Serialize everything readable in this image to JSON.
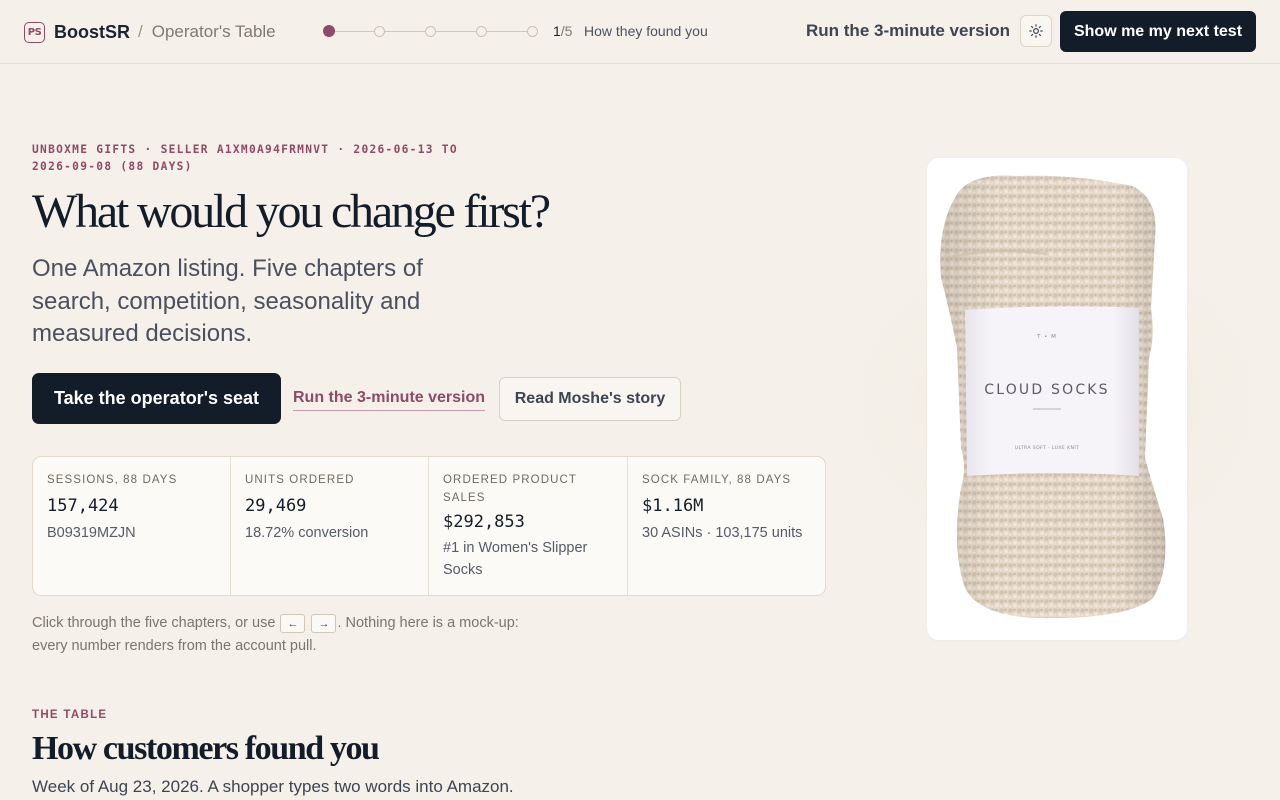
{
  "topbar": {
    "logo_text": "PS",
    "brand": "BoostSR",
    "separator": "/",
    "crumb": "Operator's Table",
    "progress": {
      "current": 1,
      "total": 5,
      "current_text": "1",
      "total_text": "/5"
    },
    "step_label": "How they found you",
    "quick_link": "Run the 3-minute version",
    "theme_icon": "sun-icon",
    "cta": "Show me my next test"
  },
  "hero": {
    "eyebrow": "UNBOXME GIFTS · SELLER A1XM0A94FRMNVT · 2026-06-13 TO 2026-09-08 (88 DAYS)",
    "title": "What would you change first?",
    "subtitle": "One Amazon listing. Five chapters of search, competition, seasonality and measured decisions.",
    "primary_button": "Take the operator's seat",
    "link_button": "Run the 3-minute version",
    "secondary_button": "Read Moshe's story"
  },
  "stats": [
    {
      "label": "SESSIONS, 88 DAYS",
      "value": "157,424",
      "sub": "B09319MZJN"
    },
    {
      "label": "UNITS ORDERED",
      "value": "29,469",
      "sub": "18.72% conversion"
    },
    {
      "label": "ORDERED PRODUCT SALES",
      "value": "$292,853",
      "sub": "#1 in Women's Slipper Socks"
    },
    {
      "label": "SOCK FAMILY, 88 DAYS",
      "value": "$1.16M",
      "sub": "30 ASINs · 103,175 units"
    }
  ],
  "hint": {
    "before": "Click through the five chapters, or use ",
    "key_prev": "←",
    "key_next": "→",
    "after": ". Nothing here is a mock-up: every number renders from the account pull."
  },
  "section": {
    "eyebrow": "THE TABLE",
    "title": "How customers found you",
    "subtitle": "Week of Aug 23, 2026. A shopper types two words into Amazon."
  },
  "product": {
    "band_mark": "T • M",
    "band_title": "CLOUD SOCKS",
    "band_tagline": "ULTRA SOFT · LUXE KNIT",
    "colors": {
      "sock": "#e3d6c7",
      "band": "#f4f2f6"
    }
  },
  "colors": {
    "background": "#f5f1ea",
    "accent": "#8e4a66",
    "ink": "#131c29"
  }
}
